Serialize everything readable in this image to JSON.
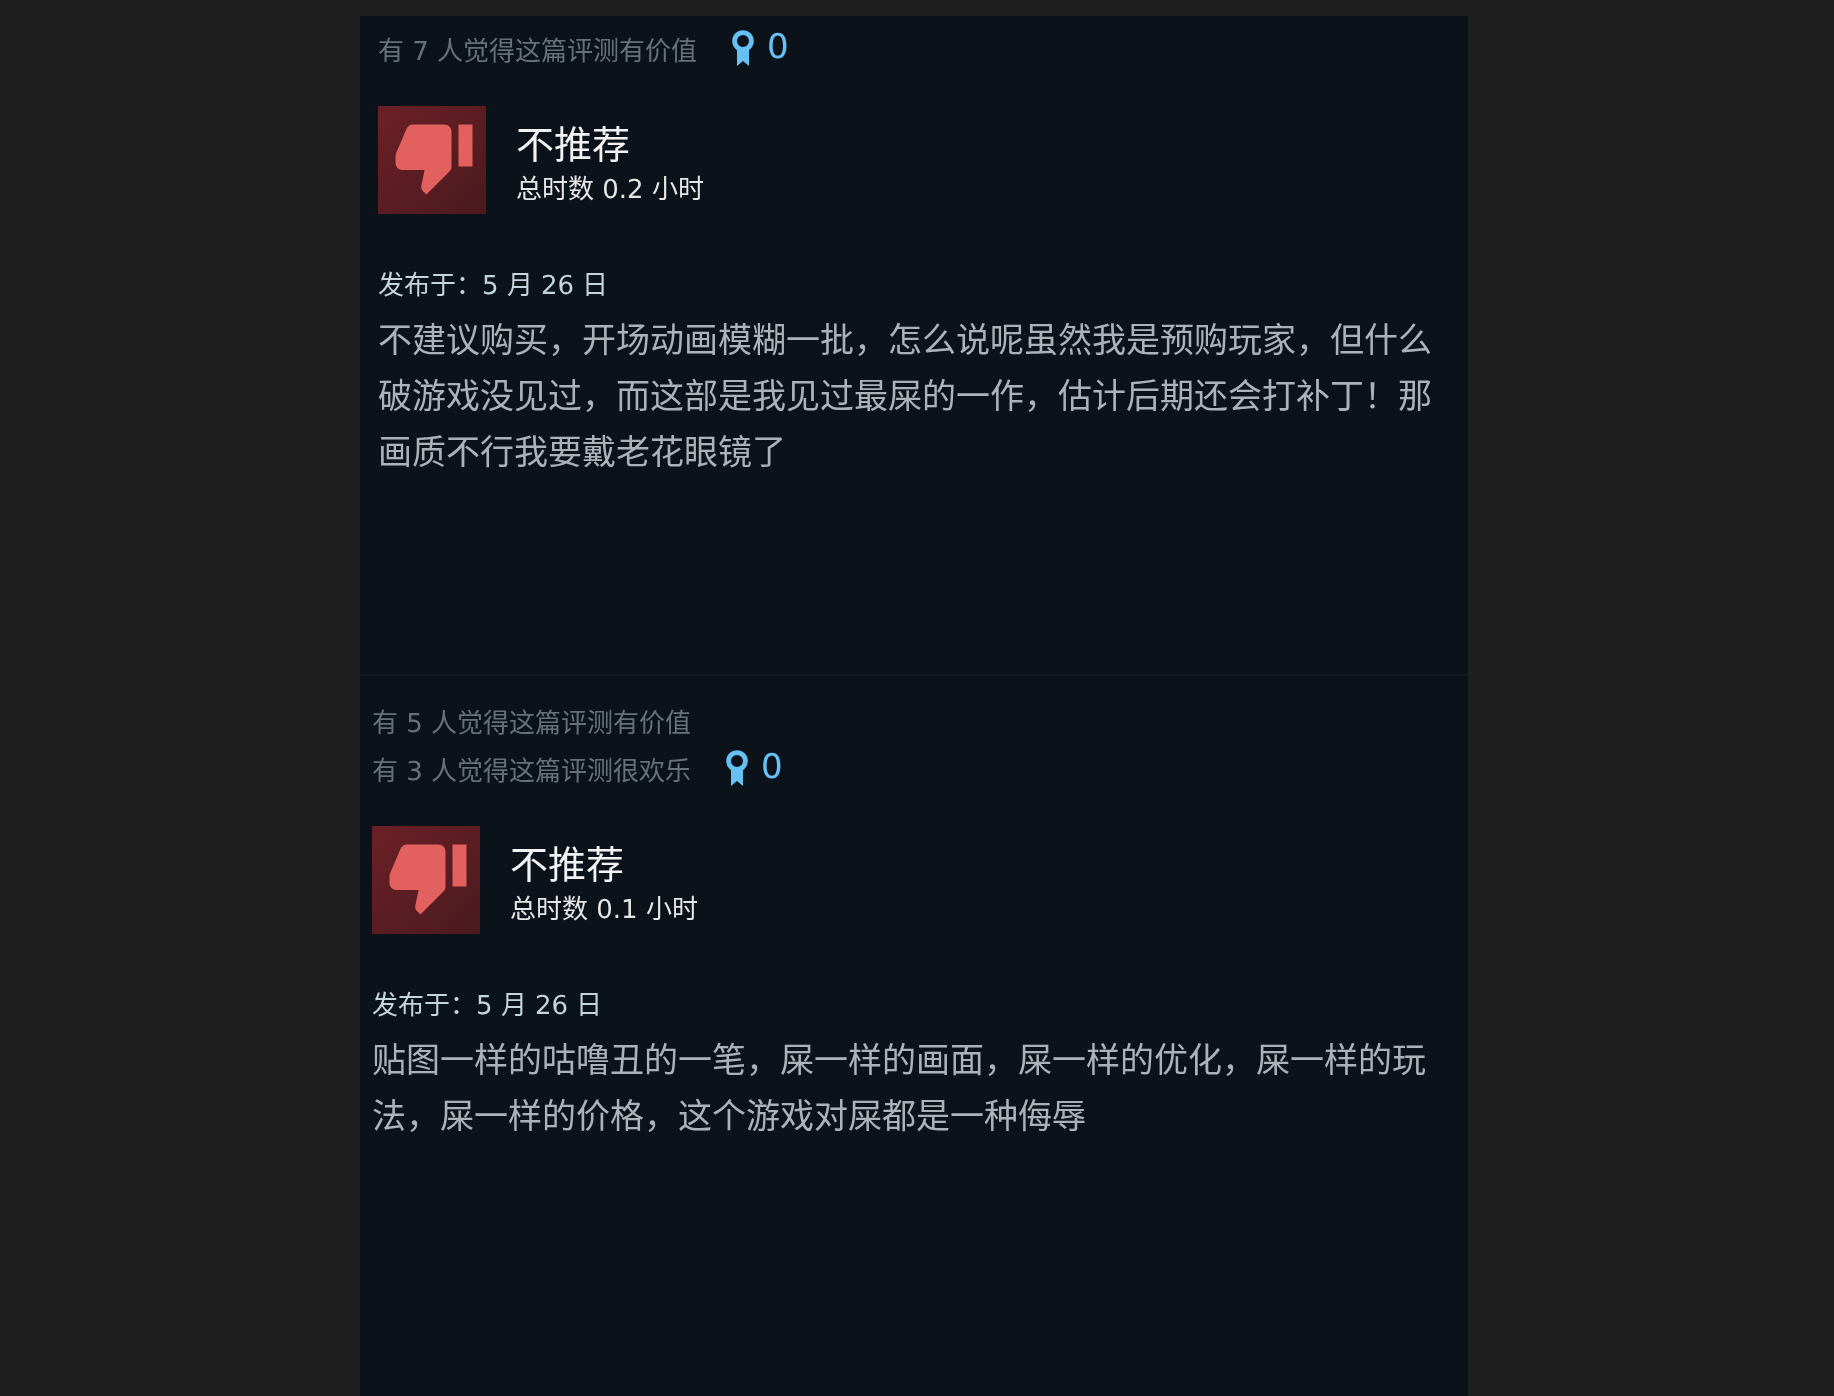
{
  "reviews": [
    {
      "helpful": [
        "有 7 人觉得这篇评测有价值"
      ],
      "award_count": "0",
      "recommended": false,
      "verdict": "不推荐",
      "hours": "总时数 0.2 小时",
      "posted": "发布于：5 月 26 日",
      "body": "不建议购买，开场动画模糊一批，怎么说呢虽然我是预购玩家，但什么破游戏没见过，而这部是我见过最屎的一作，估计后期还会打补丁！那画质不行我要戴老花眼镜了"
    },
    {
      "helpful": [
        "有 5 人觉得这篇评测有价值",
        "有 3 人觉得这篇评测很欢乐"
      ],
      "award_count": "0",
      "recommended": false,
      "verdict": "不推荐",
      "hours": "总时数 0.1 小时",
      "posted": "发布于：5 月 26 日",
      "body": "贴图一样的咕噜丑的一笔，屎一样的画面，屎一样的优化，屎一样的玩法，屎一样的价格，这个游戏对屎都是一种侮辱"
    }
  ]
}
